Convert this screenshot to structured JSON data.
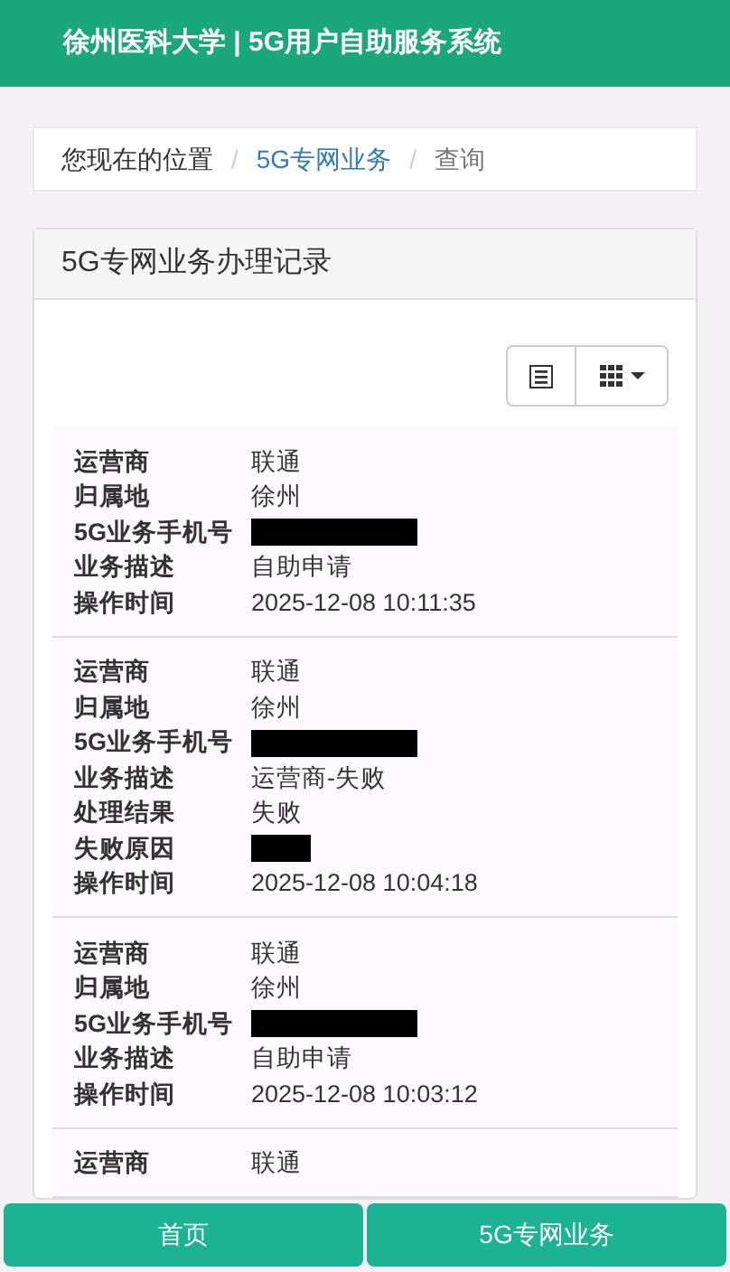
{
  "header": {
    "title": "徐州医科大学 | 5G用户自助服务系统"
  },
  "breadcrumb_separator": "/",
  "breadcrumb": [
    {
      "label": "您现在的位置",
      "kind": "text"
    },
    {
      "label": "5G专网业务",
      "kind": "link"
    },
    {
      "label": "查询",
      "kind": "current"
    }
  ],
  "panel": {
    "title": "5G专网业务办理记录"
  },
  "records": [
    {
      "fields": [
        {
          "label": "运营商",
          "value": "联通"
        },
        {
          "label": "归属地",
          "value": "徐州"
        },
        {
          "label": "5G业务手机号",
          "redacted": true
        },
        {
          "label": "业务描述",
          "value": "自助申请"
        },
        {
          "label": "操作时间",
          "value": "2025-12-08 10:11:35"
        }
      ]
    },
    {
      "fields": [
        {
          "label": "运营商",
          "value": "联通"
        },
        {
          "label": "归属地",
          "value": "徐州"
        },
        {
          "label": "5G业务手机号",
          "redacted": true
        },
        {
          "label": "业务描述",
          "value": "运营商-失败"
        },
        {
          "label": "处理结果",
          "value": "失败"
        },
        {
          "label": "失败原因",
          "redacted": true,
          "short": true
        },
        {
          "label": "操作时间",
          "value": "2025-12-08 10:04:18"
        }
      ]
    },
    {
      "fields": [
        {
          "label": "运营商",
          "value": "联通"
        },
        {
          "label": "归属地",
          "value": "徐州"
        },
        {
          "label": "5G业务手机号",
          "redacted": true
        },
        {
          "label": "业务描述",
          "value": "自助申请"
        },
        {
          "label": "操作时间",
          "value": "2025-12-08 10:03:12"
        }
      ]
    },
    {
      "fields": [
        {
          "label": "运营商",
          "value": "联通"
        }
      ]
    }
  ],
  "bottom_nav": [
    {
      "label": "首页"
    },
    {
      "label": "5G专网业务"
    }
  ]
}
